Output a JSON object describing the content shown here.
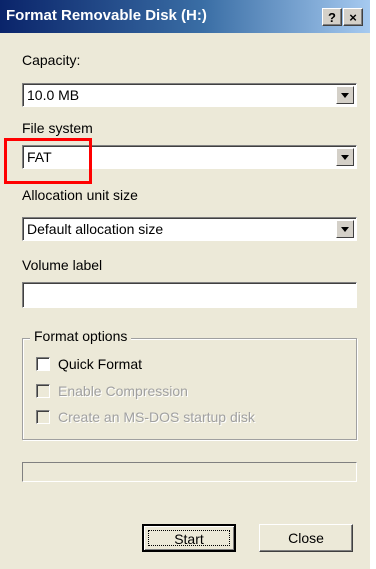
{
  "window": {
    "title": "Format Removable Disk (H:)",
    "help_button": "?",
    "close_button": "×"
  },
  "capacity": {
    "label": "Capacity:",
    "value": "10.0 MB"
  },
  "file_system": {
    "label": "File system",
    "value": "FAT"
  },
  "allocation": {
    "label": "Allocation unit size",
    "value": "Default allocation size"
  },
  "volume_label": {
    "label": "Volume label",
    "value": ""
  },
  "format_options": {
    "title": "Format options",
    "quick_format": {
      "label": "Quick Format",
      "checked": false,
      "enabled": true
    },
    "enable_compression": {
      "label": "Enable Compression",
      "checked": false,
      "enabled": false
    },
    "ms_dos_startup": {
      "label": "Create an MS-DOS startup disk",
      "checked": false,
      "enabled": false
    }
  },
  "progress": {
    "fraction": 0
  },
  "buttons": {
    "start": "Start",
    "close": "Close"
  },
  "colors": {
    "highlight": "#ff0000",
    "title_bar": "#0a246a",
    "dialog_bg": "#ece9d8"
  }
}
